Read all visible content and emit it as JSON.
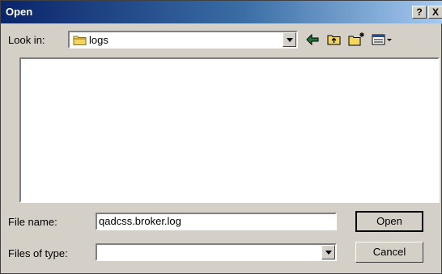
{
  "title": "Open",
  "titlebar": {
    "help": "?",
    "close": "X"
  },
  "lookin": {
    "label": "Look in:",
    "value": "logs"
  },
  "toolbar": {
    "icons": [
      "back-icon",
      "up-folder-icon",
      "new-folder-icon",
      "view-menu-icon"
    ]
  },
  "filename": {
    "label": "File name:",
    "value": "qadcss.broker.log"
  },
  "filetype": {
    "label": "Files of type:",
    "value": ""
  },
  "buttons": {
    "open": "Open",
    "cancel": "Cancel"
  }
}
